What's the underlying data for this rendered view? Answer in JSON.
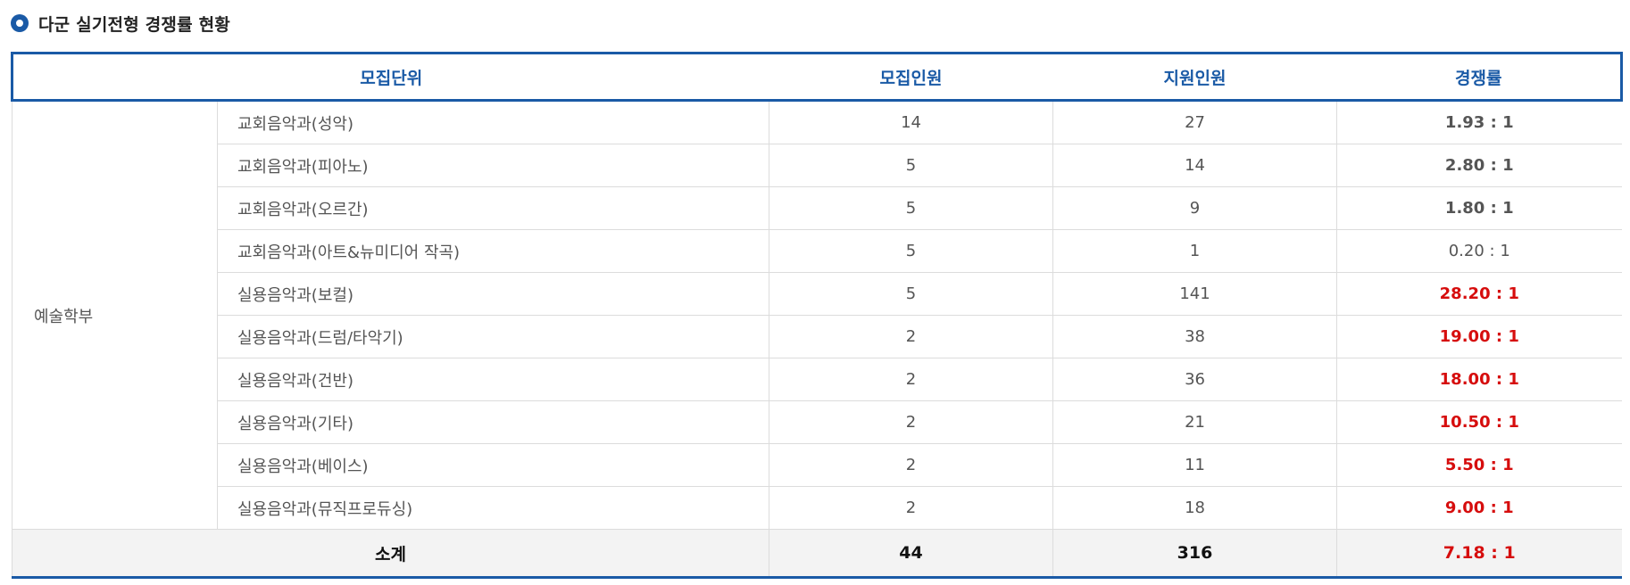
{
  "section_title": "다군 실기전형 경쟁률 현황",
  "headers": {
    "unit": "모집단위",
    "quota": "모집인원",
    "applicants": "지원인원",
    "ratio": "경쟁률"
  },
  "group": "예술학부",
  "rows": [
    {
      "unit": "교회음악과(성악)",
      "quota": "14",
      "applicants": "27",
      "ratio": "1.93 : 1"
    },
    {
      "unit": "교회음악과(피아노)",
      "quota": "5",
      "applicants": "14",
      "ratio": "2.80 : 1"
    },
    {
      "unit": "교회음악과(오르간)",
      "quota": "5",
      "applicants": "9",
      "ratio": "1.80 : 1"
    },
    {
      "unit": "교회음악과(아트&뉴미디어 작곡)",
      "quota": "5",
      "applicants": "1",
      "ratio": "0.20 : 1"
    },
    {
      "unit": "실용음악과(보컬)",
      "quota": "5",
      "applicants": "141",
      "ratio": "28.20 : 1"
    },
    {
      "unit": "실용음악과(드럼/타악기)",
      "quota": "2",
      "applicants": "38",
      "ratio": "19.00 : 1"
    },
    {
      "unit": "실용음악과(건반)",
      "quota": "2",
      "applicants": "36",
      "ratio": "18.00 : 1"
    },
    {
      "unit": "실용음악과(기타)",
      "quota": "2",
      "applicants": "21",
      "ratio": "10.50 : 1"
    },
    {
      "unit": "실용음악과(베이스)",
      "quota": "2",
      "applicants": "11",
      "ratio": "5.50 : 1"
    },
    {
      "unit": "실용음악과(뮤직프로듀싱)",
      "quota": "2",
      "applicants": "18",
      "ratio": "9.00 : 1"
    }
  ],
  "total": {
    "label": "소계",
    "quota": "44",
    "applicants": "316",
    "ratio": "7.18 : 1"
  },
  "colors": {
    "accent": "#1a5aa6",
    "highlight": "#d60d0d",
    "text": "#555555",
    "total_bg": "#f3f3f3"
  }
}
